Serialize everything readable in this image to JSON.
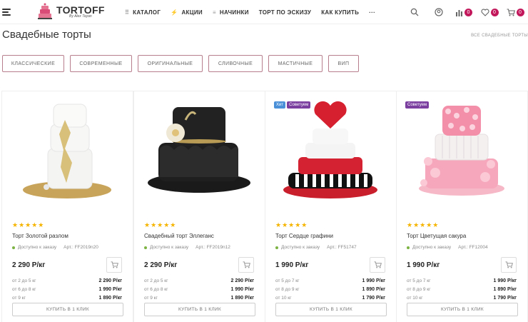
{
  "header": {
    "logo_text": "TORTOFF",
    "logo_sub": "By Alex Tayan",
    "nav": [
      {
        "icon": "grid-icon",
        "label": "КАТАЛОГ"
      },
      {
        "icon": "bolt-icon",
        "label": "АКЦИИ"
      },
      {
        "icon": "list-icon",
        "label": "НАЧИНКИ"
      },
      {
        "icon": "",
        "label": "ТОРТ ПО ЭСКИЗУ"
      },
      {
        "icon": "",
        "label": "КАК КУПИТЬ"
      },
      {
        "icon": "more-icon",
        "label": "···"
      }
    ],
    "compare_count": "0",
    "favorites_count": "0",
    "cart_count": "0"
  },
  "page": {
    "title": "Свадебные торты",
    "breadcrumb": "ВСЕ СВАДЕБНЫЕ ТОРТЫ"
  },
  "filters": [
    "КЛАССИЧЕСКИЕ",
    "СОВРЕМЕННЫЕ",
    "ОРИГИНАЛЬНЫЕ",
    "СЛИВОЧНЫЕ",
    "МАСТИЧНЫЕ",
    "ВИП"
  ],
  "products": [
    {
      "name": "Торт Золотой разлом",
      "stars": "★★★★★",
      "availability": "Доступно к заказу",
      "article": "Арт.: FF2019n20",
      "price": "2 290 Р/кг",
      "labels": [],
      "tiers": [
        {
          "range": "от 2 до 5 кг",
          "price": "2 290 Р/кг"
        },
        {
          "range": "от 6 до 8 кг",
          "price": "1 990 Р/кг"
        },
        {
          "range": "от 9 кг",
          "price": "1 890 Р/кг"
        }
      ],
      "buy_label": "КУПИТЬ В 1 КЛИК"
    },
    {
      "name": "Свадебный торт Эллеганс",
      "stars": "★★★★★",
      "availability": "Доступно к заказу",
      "article": "Арт.: FF2019n12",
      "price": "2 290 Р/кг",
      "labels": [],
      "tiers": [
        {
          "range": "от 2 до 5 кг",
          "price": "2 290 Р/кг"
        },
        {
          "range": "от 6 до 8 кг",
          "price": "1 990 Р/кг"
        },
        {
          "range": "от 9 кг",
          "price": "1 890 Р/кг"
        }
      ],
      "buy_label": "КУПИТЬ В 1 КЛИК"
    },
    {
      "name": "Торт Сердце графини",
      "stars": "★★★★★",
      "availability": "Доступно к заказу",
      "article": "Арт.: FF51747",
      "price": "1 990 Р/кг",
      "labels": [
        {
          "text": "Хит",
          "color": "#4a90d9"
        },
        {
          "text": "Советуем",
          "color": "#7b3fa0"
        }
      ],
      "tiers": [
        {
          "range": "от 5 до 7 кг",
          "price": "1 990 Р/кг"
        },
        {
          "range": "от 8 до 9 кг",
          "price": "1 890 Р/кг"
        },
        {
          "range": "от 10 кг",
          "price": "1 790 Р/кг"
        }
      ],
      "buy_label": "КУПИТЬ В 1 КЛИК"
    },
    {
      "name": "Торт Цветущая сакура",
      "stars": "★★★★★",
      "availability": "Доступно к заказу",
      "article": "Арт.: FF12004",
      "price": "1 990 Р/кг",
      "labels": [
        {
          "text": "Советуем",
          "color": "#7b3fa0"
        }
      ],
      "tiers": [
        {
          "range": "от 5 до 7 кг",
          "price": "1 990 Р/кг"
        },
        {
          "range": "от 8 до 9 кг",
          "price": "1 890 Р/кг"
        },
        {
          "range": "от 10 кг",
          "price": "1 790 Р/кг"
        }
      ],
      "buy_label": "КУПИТЬ В 1 КЛИК"
    }
  ]
}
